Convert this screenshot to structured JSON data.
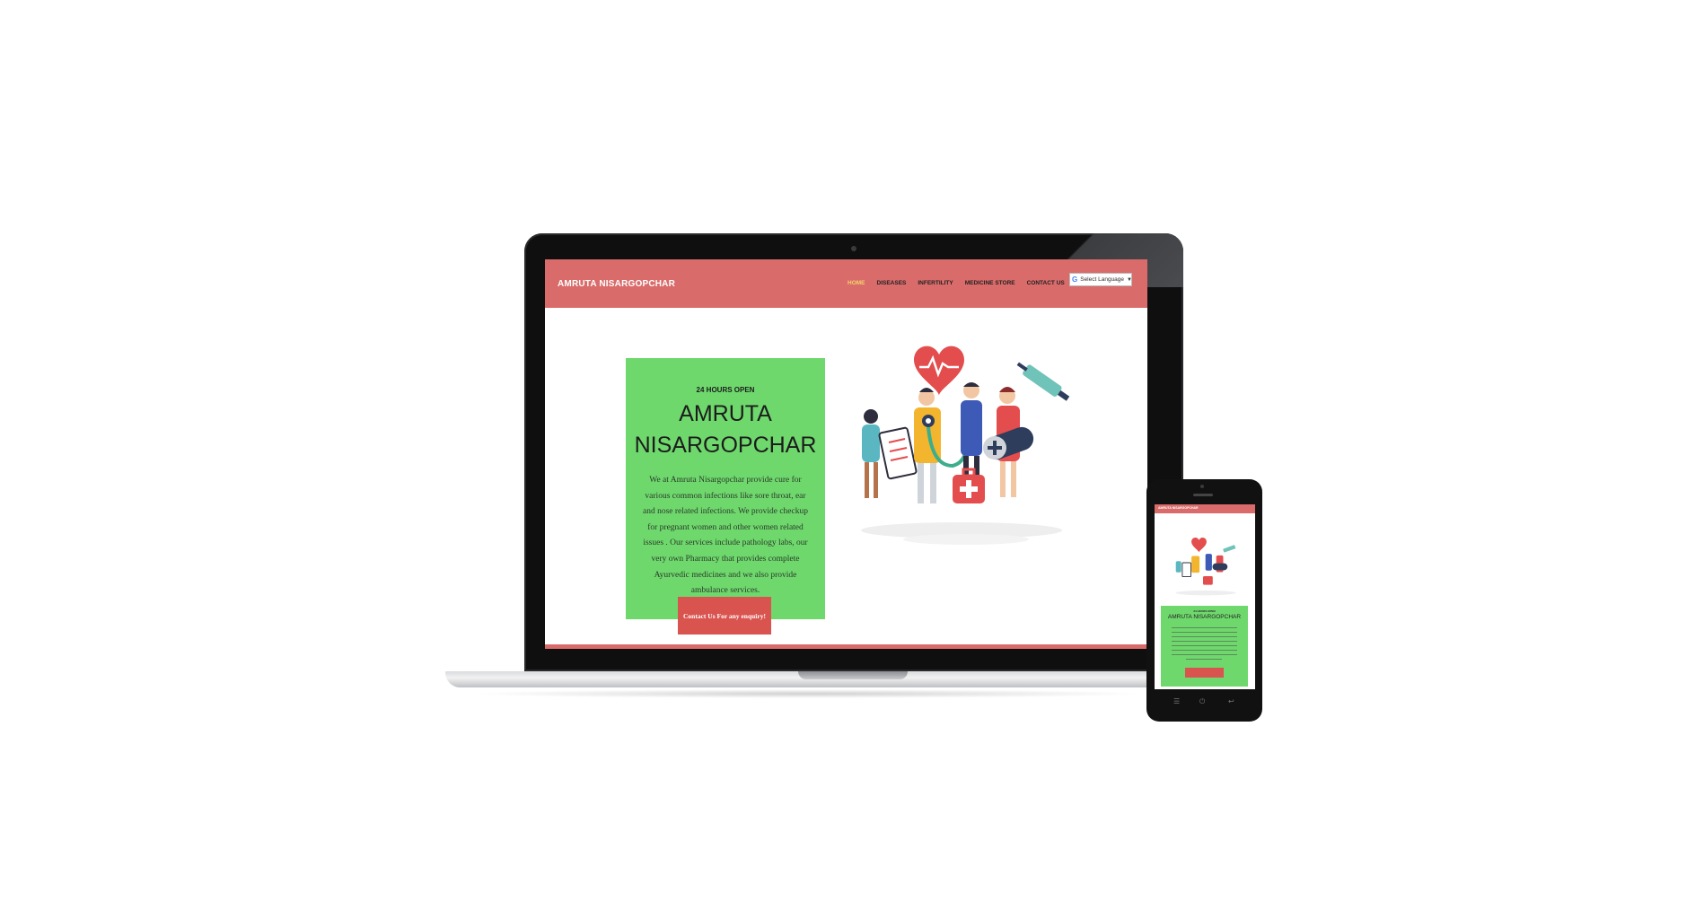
{
  "laptop_site": {
    "brand": "AMRUTA NISARGOPCHAR",
    "nav": {
      "home": "HOME",
      "diseases": "DISEASES",
      "infertility": "INFERTILITY",
      "medicine_store": "MEDICINE STORE",
      "contact_us": "CONTACT US"
    },
    "language_select": "Select Language",
    "hero": {
      "kicker": "24 HOURS OPEN",
      "title_line1": "AMRUTA",
      "title_line2": "NISARGOPCHAR",
      "description": "We at Amruta Nisargopchar provide cure for various common infections like sore throat, ear and nose related infections. We provide checkup for pregnant women and other women related issues . Our services include pathology labs, our very own Pharmacy that provides complete Ayurvedic medicines and we also provide ambulance services.",
      "cta_label": "Contact Us For any enquiry!"
    }
  },
  "phone_site": {
    "brand": "AMRUTA NISARGOPCHAR",
    "kicker": "24 HOURS OPEN",
    "title": "AMRUTA NISARGOPCHAR"
  },
  "colors": {
    "header": "#d96b6a",
    "hero_card": "#6fd86d",
    "cta": "#d9534f",
    "active_nav": "#f4d36a"
  },
  "icons": {
    "google": "google-g-icon",
    "dropdown": "caret-down-icon",
    "illustration": "medical-team-illustration"
  }
}
